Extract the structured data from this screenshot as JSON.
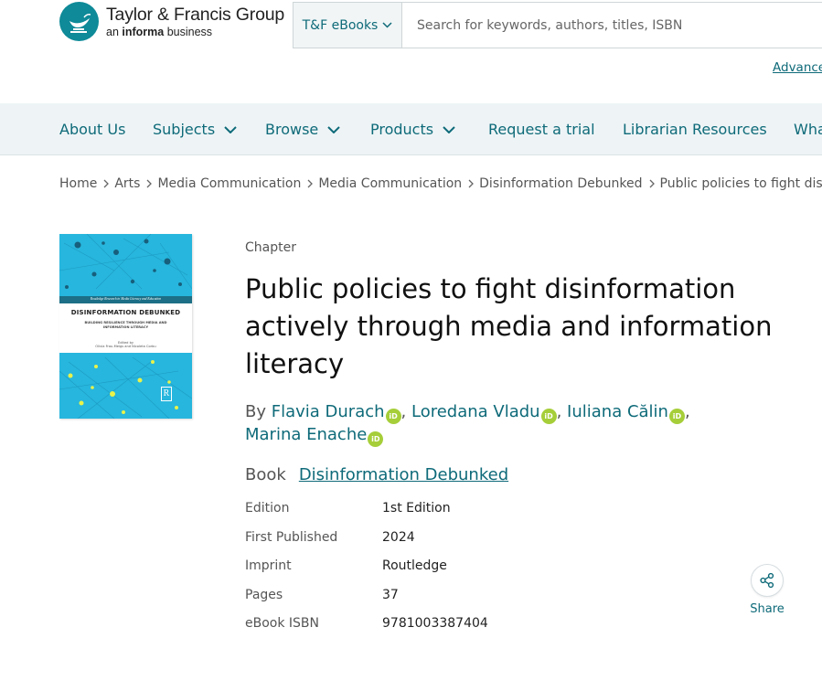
{
  "header": {
    "logo_title": "Taylor & Francis Group",
    "logo_sub_prefix": "an ",
    "logo_sub_bold": "informa",
    "logo_sub_suffix": " business",
    "search_type": "T&F eBooks",
    "search_placeholder": "Search for keywords, authors, titles, ISBN",
    "advanced_link": "Advance"
  },
  "nav": {
    "items": [
      {
        "label": "About Us",
        "dropdown": false
      },
      {
        "label": "Subjects",
        "dropdown": true
      },
      {
        "label": "Browse",
        "dropdown": true
      },
      {
        "label": "Products",
        "dropdown": true
      },
      {
        "label": "Request a trial",
        "dropdown": false
      },
      {
        "label": "Librarian Resources",
        "dropdown": false
      },
      {
        "label": "Wha",
        "dropdown": false
      }
    ]
  },
  "breadcrumb": [
    "Home",
    "Arts",
    "Media Communication",
    "Media Communication",
    "Disinformation Debunked",
    "Public policies to fight disinf"
  ],
  "cover": {
    "series": "Routledge Research in Media Literacy and Education",
    "title": "DISINFORMATION DEBUNKED",
    "subtitle_line1": "BUILDING RESILIENCE THROUGH MEDIA AND",
    "subtitle_line2": "INFORMATION LITERACY",
    "edited_by": "Edited by",
    "editors": "Olivia Frau-Meigs and Nicoleta Corbu",
    "publisher_mark": "R"
  },
  "chapter": {
    "type_label": "Chapter",
    "title": "Public policies to fight disinformation actively through media and information literacy",
    "by_label": "By ",
    "authors": [
      "Flavia Durach",
      "Loredana Vladu",
      "Iuliana Călin",
      "Marina Enache"
    ],
    "orcid_label": "iD",
    "book_label": "Book",
    "book_title": "Disinformation Debunked"
  },
  "meta": [
    {
      "key": "Edition",
      "value": "1st Edition"
    },
    {
      "key": "First Published",
      "value": "2024"
    },
    {
      "key": "Imprint",
      "value": "Routledge"
    },
    {
      "key": "Pages",
      "value": "37"
    },
    {
      "key": "eBook ISBN",
      "value": "9781003387404"
    }
  ],
  "share": {
    "label": "Share"
  },
  "colors": {
    "brand_teal": "#0e8a98",
    "link": "#0e6a79",
    "nav_bg": "#eef4f6",
    "orcid": "#a6ce39",
    "cover_blue": "#27b6dd"
  }
}
